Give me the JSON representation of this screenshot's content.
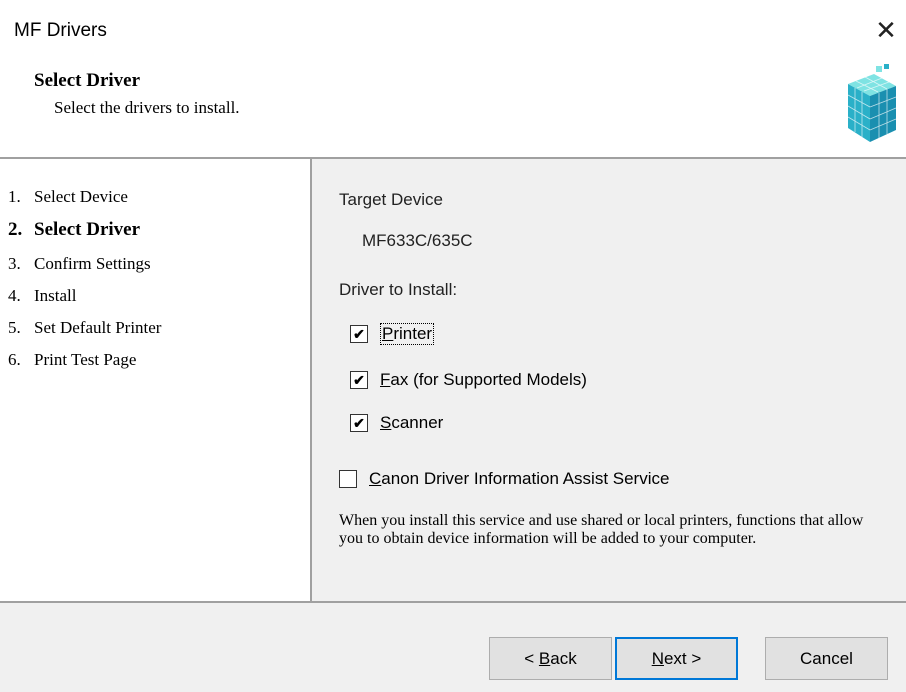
{
  "window": {
    "title": "MF Drivers",
    "close_glyph": "✕"
  },
  "header": {
    "title": "Select Driver",
    "subtitle": "Select the drivers to install.",
    "icon": "canon-cube-icon"
  },
  "steps": [
    {
      "num": "1.",
      "label": "Select Device",
      "active": false
    },
    {
      "num": "2.",
      "label": "Select Driver",
      "active": true
    },
    {
      "num": "3.",
      "label": "Confirm Settings",
      "active": false
    },
    {
      "num": "4.",
      "label": "Install",
      "active": false
    },
    {
      "num": "5.",
      "label": "Set Default Printer",
      "active": false
    },
    {
      "num": "6.",
      "label": "Print Test Page",
      "active": false
    }
  ],
  "content": {
    "target_label": "Target Device",
    "target_value": "MF633C/635C",
    "driver_label": "Driver to Install:",
    "drivers": [
      {
        "key": "P",
        "rest": "rinter",
        "checked": true
      },
      {
        "key": "F",
        "rest": "ax (for Supported Models)",
        "checked": true
      },
      {
        "key": "S",
        "rest": "canner",
        "checked": true
      }
    ],
    "assist": {
      "key": "C",
      "rest": "anon Driver Information Assist Service",
      "checked": false
    },
    "description": "When you install this service and use shared or local printers, functions that allow you to obtain device information will be added to your computer."
  },
  "footer": {
    "back": {
      "prefix": "< ",
      "key": "B",
      "rest": "ack"
    },
    "next": {
      "key": "N",
      "rest": "ext >"
    },
    "cancel": "Cancel"
  },
  "check_glyph": "✔"
}
